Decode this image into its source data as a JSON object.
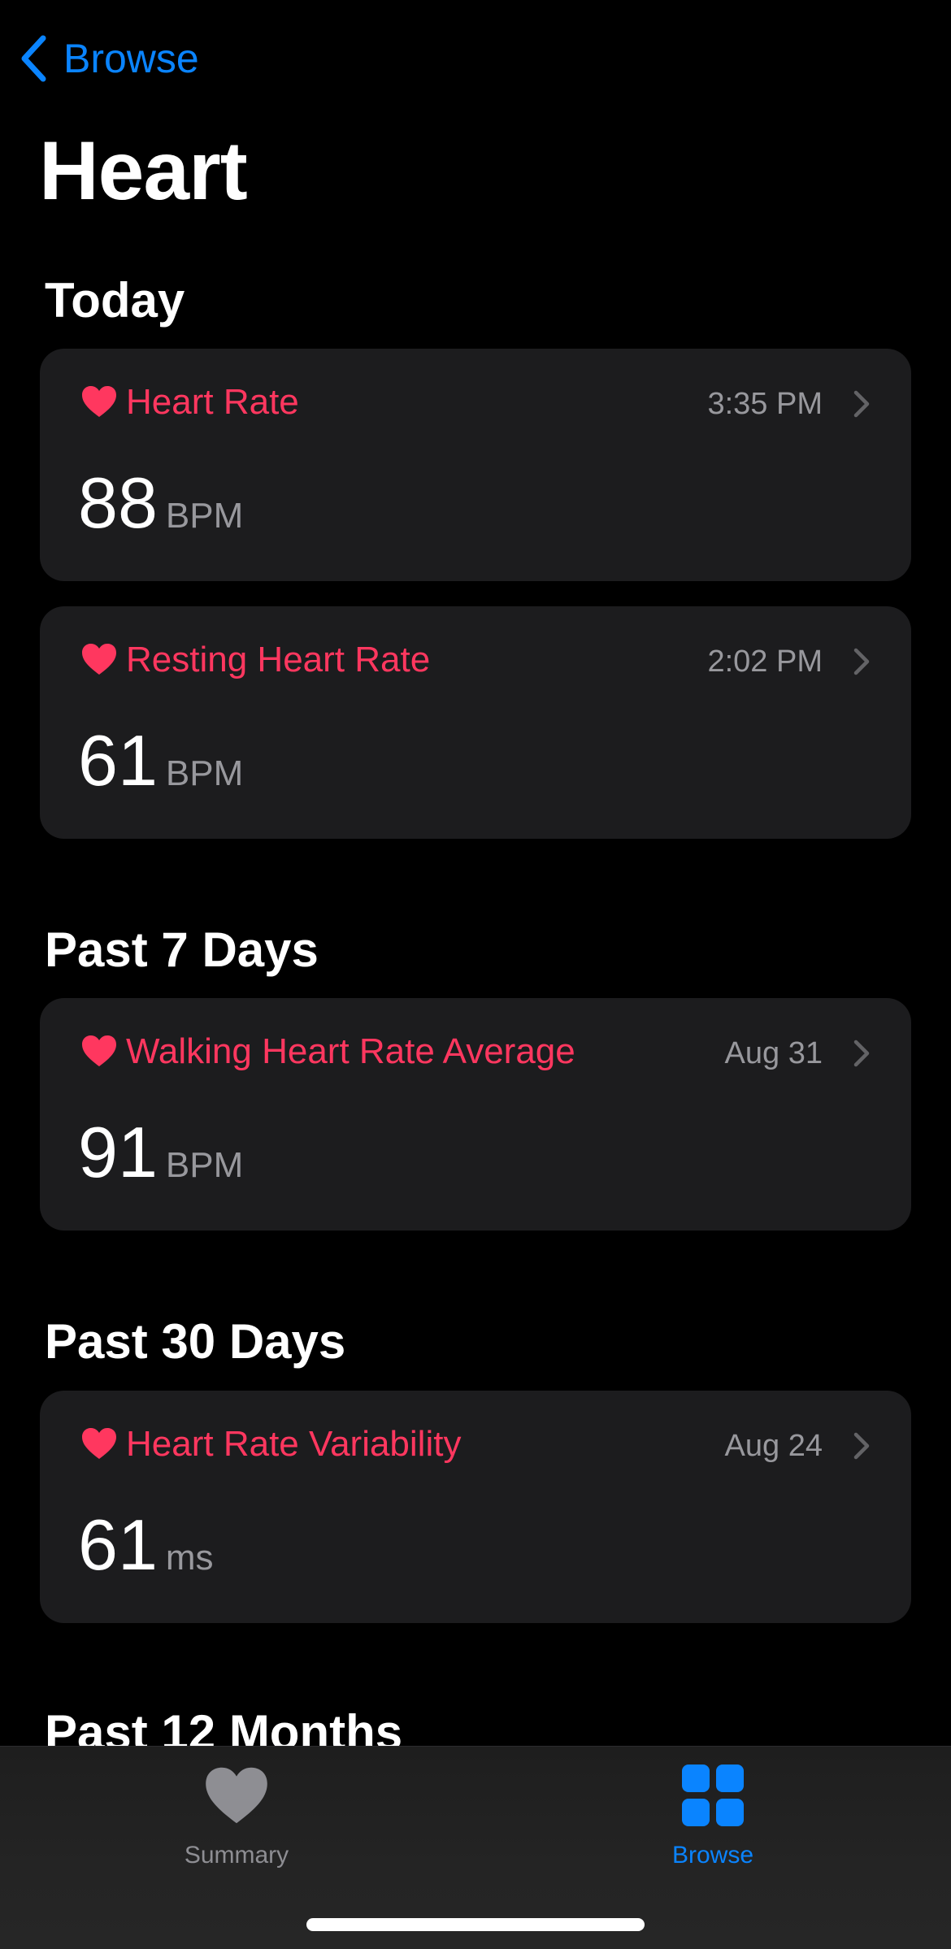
{
  "nav": {
    "back_label": "Browse",
    "title": "Heart"
  },
  "colors": {
    "accent": "#0a84ff",
    "heart": "#ff375f",
    "card": "#1c1c1e",
    "secondary_text": "#98989d"
  },
  "sections": [
    {
      "header": "Today",
      "cards": [
        {
          "icon": "heart-icon",
          "title": "Heart Rate",
          "time": "3:35 PM",
          "value": "88",
          "unit": "BPM"
        },
        {
          "icon": "heart-icon",
          "title": "Resting Heart Rate",
          "time": "2:02 PM",
          "value": "61",
          "unit": "BPM"
        }
      ]
    },
    {
      "header": "Past 7 Days",
      "cards": [
        {
          "icon": "heart-icon",
          "title": "Walking Heart Rate Average",
          "time": "Aug 31",
          "value": "91",
          "unit": "BPM"
        }
      ]
    },
    {
      "header": "Past 30 Days",
      "cards": [
        {
          "icon": "heart-icon",
          "title": "Heart Rate Variability",
          "time": "Aug 24",
          "value": "61",
          "unit": "ms"
        }
      ]
    },
    {
      "header": "Past 12 Months",
      "cards": []
    }
  ],
  "tab_bar": {
    "tabs": [
      {
        "label": "Summary",
        "icon": "heart-icon",
        "selected": false
      },
      {
        "label": "Browse",
        "icon": "grid-icon",
        "selected": true
      }
    ]
  }
}
